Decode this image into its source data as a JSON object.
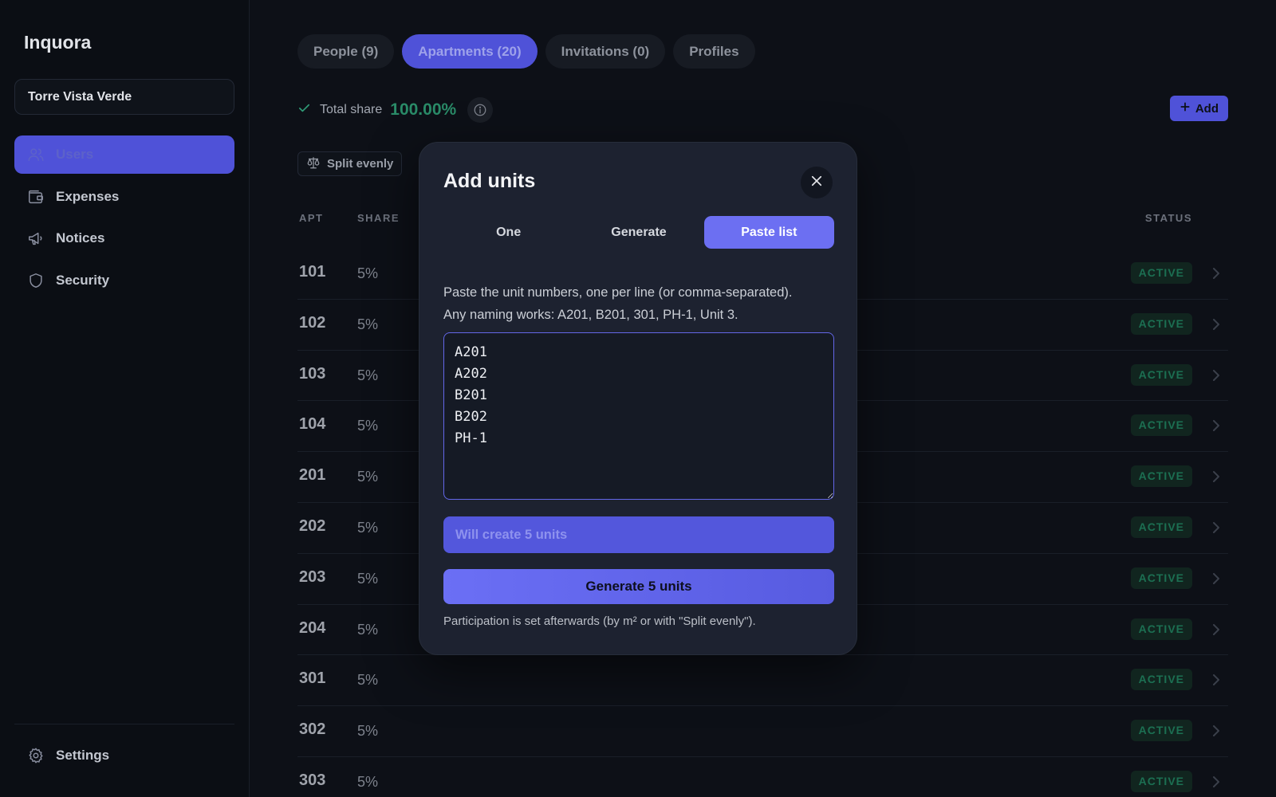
{
  "app": {
    "brand": "Inquora",
    "building": "Torre Vista Verde"
  },
  "sidebar": {
    "items": [
      {
        "label": "Users",
        "icon": "users-icon"
      },
      {
        "label": "Expenses",
        "icon": "wallet-icon"
      },
      {
        "label": "Notices",
        "icon": "megaphone-icon"
      },
      {
        "label": "Security",
        "icon": "shield-icon"
      }
    ],
    "settings": {
      "label": "Settings",
      "icon": "gear-icon"
    }
  },
  "tabs": [
    {
      "label": "People (9)"
    },
    {
      "label": "Apartments (20)"
    },
    {
      "label": "Invitations (0)"
    },
    {
      "label": "Profiles"
    }
  ],
  "share": {
    "label": "Total share",
    "value": "100.00%"
  },
  "add_button": "Add",
  "split_button": "Split evenly",
  "table": {
    "headers": {
      "apt": "APT",
      "share": "SHARE",
      "status": "STATUS"
    },
    "rows": [
      {
        "apt": "101",
        "share": "5%",
        "status": "ACTIVE"
      },
      {
        "apt": "102",
        "share": "5%",
        "status": "ACTIVE"
      },
      {
        "apt": "103",
        "share": "5%",
        "status": "ACTIVE"
      },
      {
        "apt": "104",
        "share": "5%",
        "status": "ACTIVE"
      },
      {
        "apt": "201",
        "share": "5%",
        "status": "ACTIVE"
      },
      {
        "apt": "202",
        "share": "5%",
        "status": "ACTIVE"
      },
      {
        "apt": "203",
        "share": "5%",
        "status": "ACTIVE"
      },
      {
        "apt": "204",
        "share": "5%",
        "status": "ACTIVE"
      },
      {
        "apt": "301",
        "share": "5%",
        "status": "ACTIVE"
      },
      {
        "apt": "302",
        "share": "5%",
        "status": "ACTIVE"
      },
      {
        "apt": "303",
        "share": "5%",
        "status": "ACTIVE"
      }
    ]
  },
  "modal": {
    "title": "Add units",
    "modes": [
      "One",
      "Generate",
      "Paste list"
    ],
    "active_mode": "Paste list",
    "help_line1": "Paste the unit numbers, one per line (or comma-separated).",
    "help_line2": "Any naming works: A201, B201, 301, PH-1, Unit 3.",
    "paste_value": "A201\nA202\nB201\nB202\nPH-1",
    "preview": "Will create 5 units",
    "primary": "Generate 5 units",
    "footnote": "Participation is set afterwards (by m² or with \"Split evenly\")."
  },
  "colors": {
    "accent": "#4f52d8",
    "accent_bright": "#6c6ff2",
    "success": "#2a8b68",
    "background": "#0d1017"
  }
}
